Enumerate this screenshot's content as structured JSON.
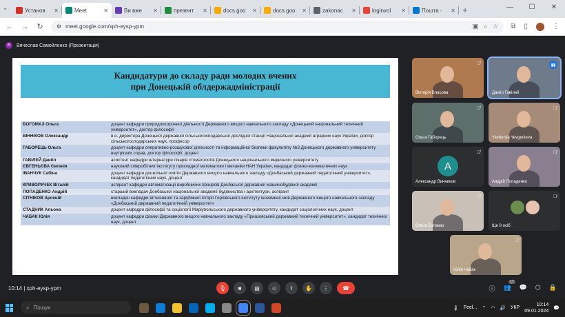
{
  "browser": {
    "tabs": [
      {
        "label": "Установ",
        "color": "#d93025"
      },
      {
        "label": "Meet",
        "color": "#00897b",
        "active": true
      },
      {
        "label": "Ви вже",
        "color": "#673ab7"
      },
      {
        "label": "презент",
        "color": "#1e8e3e"
      },
      {
        "label": "docs.goo",
        "color": "#f9ab00"
      },
      {
        "label": "docs.goo",
        "color": "#f9ab00"
      },
      {
        "label": "zakonac",
        "color": "#5f6368"
      },
      {
        "label": "loginvol",
        "color": "#ea4335"
      },
      {
        "label": "Пошта -",
        "color": "#0078d4"
      }
    ],
    "url": "meet.google.com/xph-eysp-ypm"
  },
  "meet": {
    "presenter_label": "Вячеслав Самойленко (Презентація)",
    "presenter_initial": "В",
    "meeting_code": "10:14  |  xph-eysp-ypm",
    "participant_count": "17"
  },
  "slide": {
    "title_line1": "Кандидатури до складу ради молодих вчених",
    "title_line2": "при Донецькій облдержадміністрації",
    "rows": [
      {
        "name": "БОГОМАЗ Ольга",
        "desc": "доцент кафедри природоохоронної діяльності Державного вищого навчального закладу «Донецький національний технічний університет», доктор філософії"
      },
      {
        "name": "ВІННІКОВ Олександр",
        "desc": "в.о. директора Донецької державної сільськогосподарської дослідної станції Національної академії аграрних наук України, доктор сільськогосподарських наук, професор"
      },
      {
        "name": "ГАБОРЕЦЬ Ольга",
        "desc": "доцент кафедри оперативно-розшукової діяльності та інформаційної безпеки факультету №3 Донецького державного університету внутрішніх справ, доктор філософії, доцент"
      },
      {
        "name": "ГАВІЛЕЙ Даніїл",
        "desc": "асистент кафедри інтернатури лікарів стоматологів Донецького національного медичного університету"
      },
      {
        "name": "ЄВГЕНЬЄВА Євгенія",
        "desc": "науковий співробітник Інституту прикладної математики і механіки НАН України, кандидат фізико-математичних наук"
      },
      {
        "name": "ІВАНЧУК Сабіна",
        "desc": "доцент кафедри дошкільної освіти Державного вищого навчального закладу «Донбаський державний педагогічний університет», кандидат педагогічних наук, доцент"
      },
      {
        "name": "КРИВОРУЧЕК Віталій",
        "desc": "аспірант кафедри автоматизації виробничих процесів Донбаської державної машинобудівної академії"
      },
      {
        "name": "ПОПАДЕНКО Андрій",
        "desc": "старший викладач Донбаської національної академії будівництва і архітектури, аспірант"
      },
      {
        "name": "СІТНІКОВ Арсеній",
        "desc": "викладач кафедри вітчизняної та зарубіжної історії Горлівського інституту іноземних мов Державного вищого навчального закладу «Донбаський державний педагогічний університет»"
      },
      {
        "name": "СТАДНИК Альона",
        "desc": "доцент кафедри філософії та соціології Маріупольського державного університету, кандидат соціологічних наук, доцент"
      },
      {
        "name": "ЧАБАК Юлія",
        "desc": "доцент кафедри фізики Державного вищого навчального закладу «Приазовський державний технічний університет», кандидат технічних наук, доцент"
      }
    ]
  },
  "participants": [
    {
      "name": "Вікторія Власова",
      "bg": "#b07a50"
    },
    {
      "name": "Данііл Гавілей",
      "bg": "#6d7b8a",
      "speaking": true
    },
    {
      "name": "Ольга Габорець",
      "bg": "#5c6f6a"
    },
    {
      "name": "Yevheniia Yevgenieva",
      "bg": "#a58b78"
    },
    {
      "name": "Александр Винников",
      "initial": "А",
      "bg": "#2d2e30"
    },
    {
      "name": "Андрій Попаденко",
      "bg": "#8a7f8f"
    },
    {
      "name": "Ольга Богомаз",
      "bg": "#c9c1b8"
    },
    {
      "name": "Ще 8 осіб",
      "bg": "#2d2e30"
    },
    {
      "name": "Юлія Чабак",
      "bg": "#b8a58a"
    }
  ],
  "taskbar": {
    "search_placeholder": "Пошук",
    "weather": "Feel...",
    "lang": "УКР",
    "time": "10:14",
    "date": "09.01.2024"
  }
}
